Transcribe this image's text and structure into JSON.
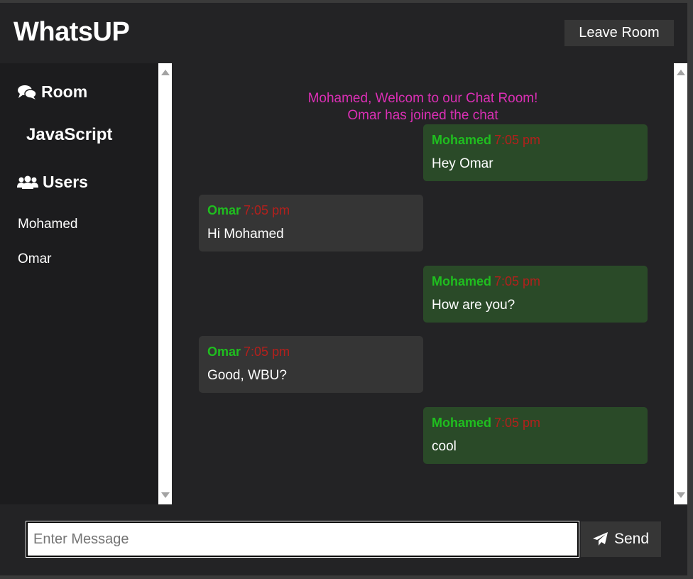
{
  "header": {
    "title": "WhatsUP",
    "leave_label": "Leave Room"
  },
  "sidebar": {
    "room_heading": "Room",
    "room_icon": "comments-icon",
    "room_name": "JavaScript",
    "users_heading": "Users",
    "users_icon": "users-icon",
    "users": [
      "Mohamed",
      "Omar"
    ]
  },
  "chat": {
    "system_messages": [
      "Mohamed, Welcom to our Chat Room!",
      "Omar has joined the chat"
    ],
    "messages": [
      {
        "user": "Mohamed",
        "time": "7:05 pm",
        "text": "Hey Omar",
        "self": true
      },
      {
        "user": "Omar",
        "time": "7:05 pm",
        "text": "Hi Mohamed",
        "self": false
      },
      {
        "user": "Mohamed",
        "time": "7:05 pm",
        "text": "How are you?",
        "self": true
      },
      {
        "user": "Omar",
        "time": "7:05 pm",
        "text": "Good, WBU?",
        "self": false
      },
      {
        "user": "Mohamed",
        "time": "7:05 pm",
        "text": "cool",
        "self": true
      }
    ]
  },
  "composer": {
    "placeholder": "Enter Message",
    "value": "",
    "send_label": "Send",
    "send_icon": "paper-plane-icon"
  },
  "colors": {
    "system_message": "#db2fb5",
    "username": "#1fbe1f",
    "timestamp": "#b3201c",
    "self_bubble": "#2a4a28",
    "other_bubble": "#353535"
  }
}
